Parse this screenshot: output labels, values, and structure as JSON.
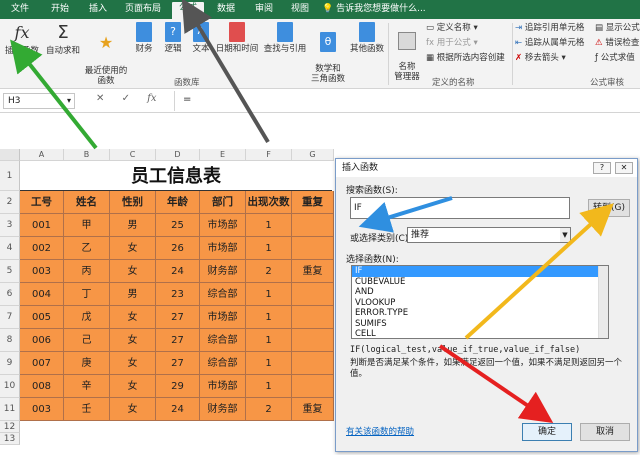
{
  "ribbon_tabs": [
    "文件",
    "开始",
    "插入",
    "页面布局",
    "公式",
    "数据",
    "审阅",
    "视图"
  ],
  "active_tab": "公式",
  "tell_me": "告诉我您想要做什么...",
  "ribbon": {
    "insert_function": "插入函数",
    "autosum": "自动求和",
    "recent": "最近使用的\n函数",
    "financial": "财务",
    "logical": "逻辑",
    "text": "文本",
    "datetime": "日期和时间",
    "lookup": "查找与引用",
    "math": "数学和\n三角函数",
    "more": "其他函数",
    "function_library": "函数库",
    "name_manager": "名称\n管理器",
    "define_name": "定义名称",
    "use_in_formula": "用于公式",
    "create_from_selection": "根据所选内容创建",
    "defined_names": "定义的名称",
    "trace_precedents": "追踪引用单元格",
    "trace_dependents": "追踪从属单元格",
    "remove_arrows": "移去箭头",
    "show_formulas": "显示公式",
    "error_checking": "错误检查",
    "evaluate_formula": "公式求值",
    "formula_auditing": "公式审核"
  },
  "formula_bar": {
    "namebox": "H3",
    "cancel": "✕",
    "enter": "✓",
    "fx": "fx",
    "equals": "="
  },
  "sheet": {
    "columns": [
      "A",
      "B",
      "C",
      "D",
      "E",
      "F",
      "G"
    ],
    "rows": [
      "1",
      "2",
      "3",
      "4",
      "5",
      "6",
      "7",
      "8",
      "9",
      "10",
      "11",
      "12",
      "13"
    ],
    "title": "员工信息表",
    "headers": [
      "工号",
      "姓名",
      "性别",
      "年龄",
      "部门",
      "出现次数",
      "重复"
    ],
    "data": [
      [
        "001",
        "甲",
        "男",
        "25",
        "市场部",
        "1",
        ""
      ],
      [
        "002",
        "乙",
        "女",
        "26",
        "市场部",
        "1",
        ""
      ],
      [
        "003",
        "丙",
        "女",
        "24",
        "财务部",
        "2",
        "重复"
      ],
      [
        "004",
        "丁",
        "男",
        "23",
        "综合部",
        "1",
        ""
      ],
      [
        "005",
        "戊",
        "女",
        "27",
        "市场部",
        "1",
        ""
      ],
      [
        "006",
        "己",
        "女",
        "27",
        "综合部",
        "1",
        ""
      ],
      [
        "007",
        "庚",
        "女",
        "27",
        "综合部",
        "1",
        ""
      ],
      [
        "008",
        "辛",
        "女",
        "29",
        "市场部",
        "1",
        ""
      ],
      [
        "003",
        "壬",
        "女",
        "24",
        "财务部",
        "2",
        "重复"
      ]
    ]
  },
  "dialog": {
    "title": "插入函数",
    "help_btn": "?",
    "close_btn": "✕",
    "search_label": "搜索函数(S):",
    "search_value": "IF",
    "go_button": "转到(G)",
    "category_label": "或选择类别(C):",
    "category_value": "推荐",
    "select_label": "选择函数(N):",
    "functions": [
      "IF",
      "CUBEVALUE",
      "AND",
      "VLOOKUP",
      "ERROR.TYPE",
      "SUMIFS",
      "CELL"
    ],
    "selected_function": "IF",
    "signature": "IF(logical_test,value_if_true,value_if_false)",
    "description": "判断是否满足某个条件，如果满足返回一个值，如果不满足则返回另一个值。",
    "help_link": "有关该函数的帮助",
    "ok": "确定",
    "cancel": "取消"
  },
  "colors": {
    "ribbon_green": "#217346",
    "cell_orange": "#f79646",
    "arrow_green": "#33aa33",
    "arrow_dark": "#555555",
    "arrow_blue": "#2f8fe0",
    "arrow_yellow": "#f2b81c",
    "arrow_red": "#e52020"
  }
}
